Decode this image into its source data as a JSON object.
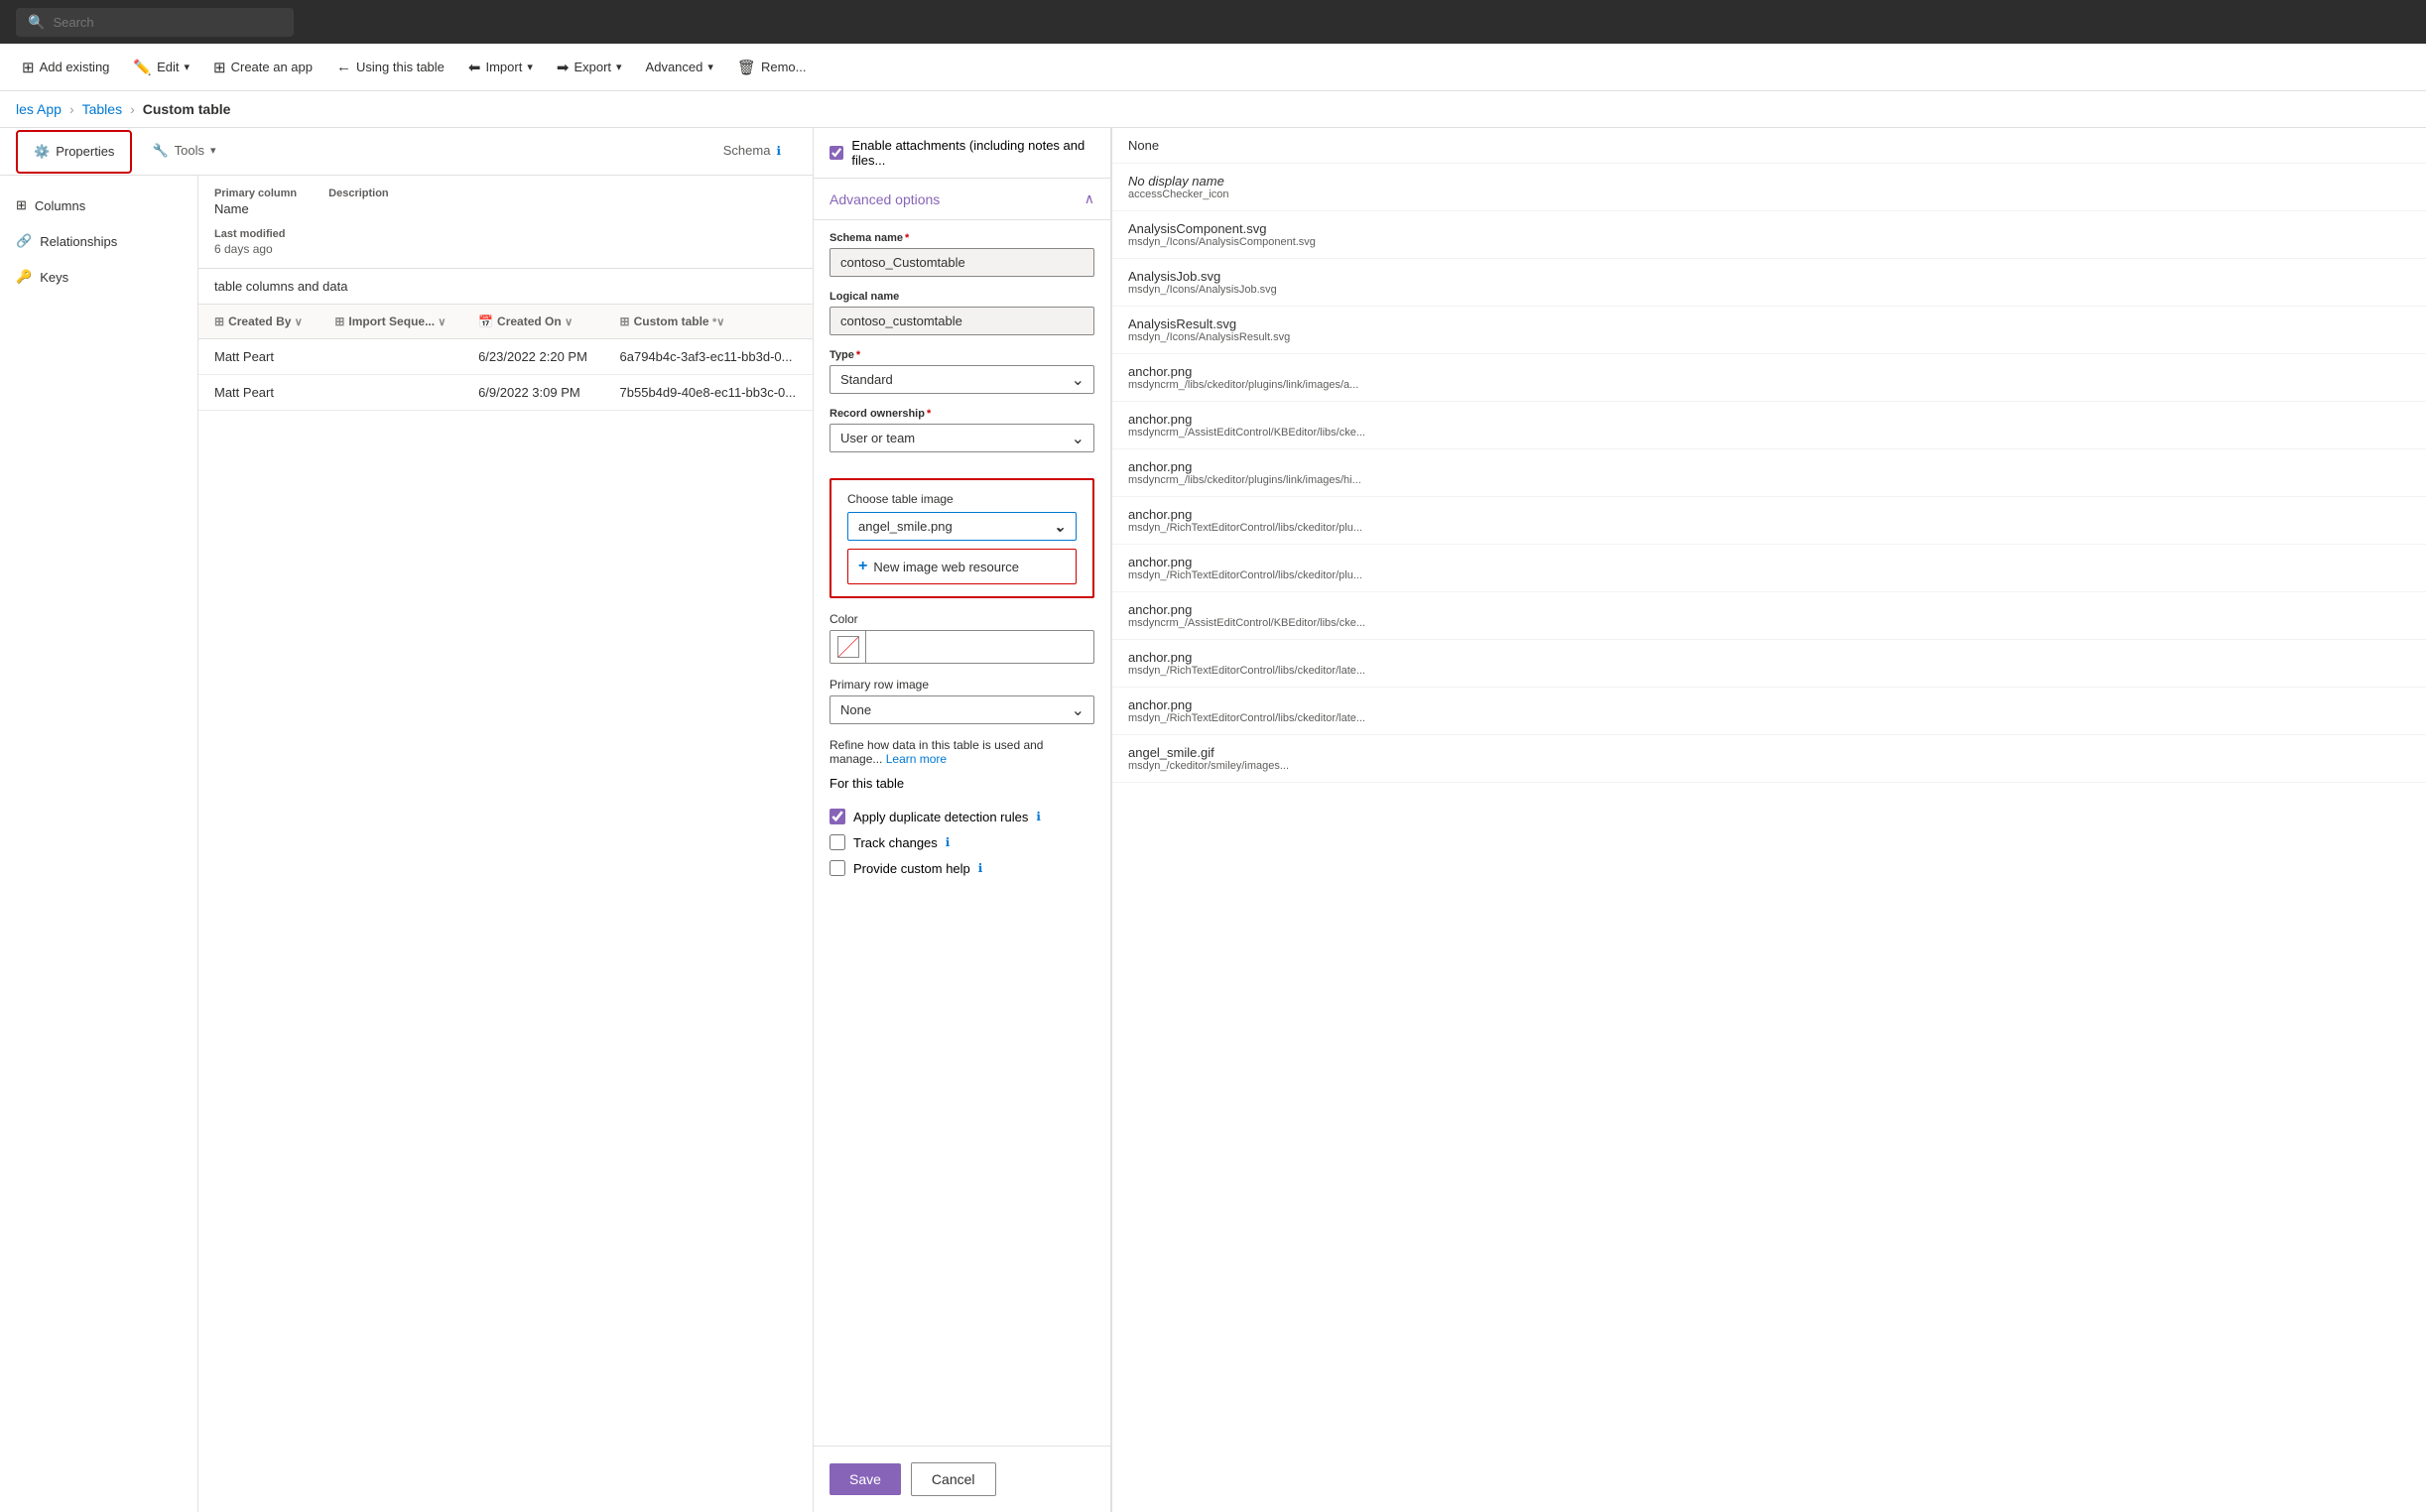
{
  "topbar": {
    "search_placeholder": "Search"
  },
  "toolbar": {
    "add_existing": "Add existing",
    "edit": "Edit",
    "create_app": "Create an app",
    "using_this_table": "Using this table",
    "import": "Import",
    "export": "Export",
    "advanced": "Advanced",
    "remove": "Remo..."
  },
  "breadcrumb": {
    "app": "les App",
    "tables": "Tables",
    "current": "Custom table"
  },
  "tabs": {
    "properties": "Properties",
    "tools": "Tools",
    "schema": "Schema"
  },
  "schema_nav": {
    "columns": "Columns",
    "relationships": "Relationships",
    "keys": "Keys"
  },
  "table_info": {
    "primary_column_label": "Primary column",
    "primary_column_value": "Name",
    "description_label": "Description",
    "last_modified_label": "Last modified",
    "last_modified_value": "6 days ago"
  },
  "data_section": {
    "title": "table columns and data",
    "columns": {
      "created_by": "Created By",
      "import_sequence": "Import Seque...",
      "created_on": "Created On",
      "custom_table": "Custom table"
    },
    "rows": [
      {
        "created_by": "Matt Peart",
        "import_sequence": "",
        "created_on": "6/23/2022 2:20 PM",
        "custom_table": "6a794b4c-3af3-ec11-bb3d-0..."
      },
      {
        "created_by": "Matt Peart",
        "import_sequence": "",
        "created_on": "6/9/2022 3:09 PM",
        "custom_table": "7b55b4d9-40e8-ec11-bb3c-0..."
      }
    ]
  },
  "properties_panel": {
    "enable_attachments_label": "Enable attachments (including notes and files...",
    "advanced_options": "Advanced options",
    "schema_name_label": "Schema name",
    "schema_name_required": true,
    "schema_name_value": "contoso_Customtable",
    "logical_name_label": "Logical name",
    "logical_name_value": "contoso_customtable",
    "type_label": "Type",
    "type_required": true,
    "type_value": "Standard",
    "record_ownership_label": "Record ownership",
    "record_ownership_required": true,
    "record_ownership_value": "User or team",
    "choose_image_label": "Choose table image",
    "image_selected": "angel_smile.png",
    "new_image_btn": "New image web resource",
    "color_label": "Color",
    "primary_row_image_label": "Primary row image",
    "primary_row_image_value": "None",
    "refine_text": "Refine how data in this table is used and manage...",
    "learn_more": "Learn more",
    "for_this_table": "For this table",
    "apply_duplicate": "Apply duplicate detection rules",
    "apply_duplicate_checked": true,
    "track_changes": "Track changes",
    "track_changes_checked": false,
    "provide_custom_help": "Provide custom help",
    "provide_custom_help_checked": false,
    "save_btn": "Save",
    "cancel_btn": "Cancel"
  },
  "dropdown_list": {
    "items": [
      {
        "name": "None",
        "path": ""
      },
      {
        "name": "No display name",
        "italic": true,
        "path": "accessChecker_icon"
      },
      {
        "name": "AnalysisComponent.svg",
        "path": "msdyn_/Icons/AnalysisComponent.svg"
      },
      {
        "name": "AnalysisJob.svg",
        "path": "msdyn_/Icons/AnalysisJob.svg"
      },
      {
        "name": "AnalysisResult.svg",
        "path": "msdyn_/Icons/AnalysisResult.svg"
      },
      {
        "name": "anchor.png",
        "path": "msdyncrm_/libs/ckeditor/plugins/link/images/a..."
      },
      {
        "name": "anchor.png",
        "path": "msdyncrm_/AssistEditControl/KBEditor/libs/cke..."
      },
      {
        "name": "anchor.png",
        "path": "msdyncrm_/libs/ckeditor/plugins/link/images/hi..."
      },
      {
        "name": "anchor.png",
        "path": "msdyn_/RichTextEditorControl/libs/ckeditor/plu..."
      },
      {
        "name": "anchor.png",
        "path": "msdyn_/RichTextEditorControl/libs/ckeditor/plu..."
      },
      {
        "name": "anchor.png",
        "path": "msdyncrm_/AssistEditControl/KBEditor/libs/cke..."
      },
      {
        "name": "anchor.png",
        "path": "msdyn_/RichTextEditorControl/libs/ckeditor/late..."
      },
      {
        "name": "anchor.png",
        "path": "msdyn_/RichTextEditorControl/libs/ckeditor/late..."
      },
      {
        "name": "angel_smile.gif",
        "path": "msdyn_/ckeditor/smiley/images..."
      }
    ]
  }
}
